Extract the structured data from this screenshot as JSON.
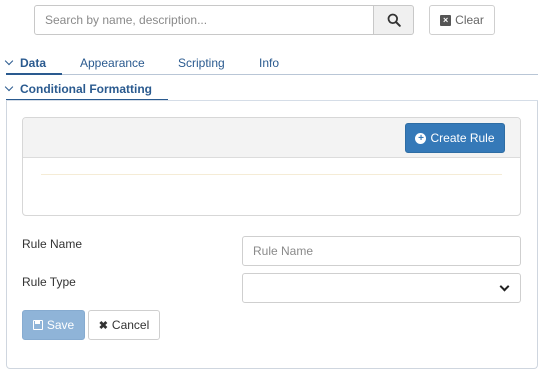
{
  "search": {
    "placeholder": "Search by name, description...",
    "icon": "search-icon"
  },
  "clear_button": {
    "label": "Clear",
    "icon": "clear-icon"
  },
  "tabs": [
    {
      "label": "Data",
      "active": true
    },
    {
      "label": "Appearance",
      "active": false
    },
    {
      "label": "Scripting",
      "active": false
    },
    {
      "label": "Info",
      "active": false
    }
  ],
  "section": {
    "title": "Conditional Formatting",
    "expanded": true
  },
  "rules": {
    "create_label": "Create Rule",
    "icon": "plus-circle-icon"
  },
  "form": {
    "rule_name_label": "Rule Name",
    "rule_name_placeholder": "Rule Name",
    "rule_name_value": "",
    "rule_type_label": "Rule Type",
    "rule_type_value": ""
  },
  "actions": {
    "save_label": "Save",
    "cancel_label": "Cancel"
  },
  "colors": {
    "accent": "#2a5a8f",
    "primary_button": "#3579b8",
    "disabled_button": "#8fb4d8"
  }
}
